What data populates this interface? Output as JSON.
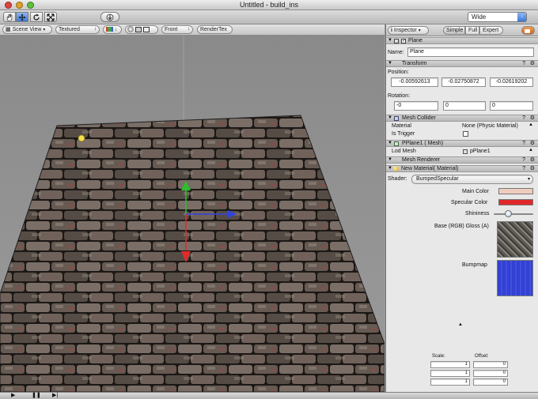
{
  "window": {
    "title": "Untitled - build_ins",
    "buttons": {
      "close": "#e0443e",
      "minimize": "#dea123",
      "zoom": "#5ec03a"
    }
  },
  "toolbar": {
    "tools": [
      "hand-icon",
      "move-icon",
      "rotate-icon",
      "scale-icon"
    ],
    "center_button": "orbit-icon",
    "layout_select": "Wide"
  },
  "scene_bar": {
    "view_select": "Scene View",
    "shading_select": "Textured",
    "front_select": "Front",
    "render_button": "RenderTex"
  },
  "inspector": {
    "tab_label": "Inspector",
    "mode_simple": "Simple",
    "mode_full": "Full",
    "mode_expert": "Expert",
    "object_header": "Plane",
    "name_label": "Name:",
    "name_value": "Plane",
    "transform": {
      "header": "Transform",
      "position_label": "Position:",
      "position": [
        "-0.00592613",
        "-0.02750872",
        "-0.02619202"
      ],
      "rotation_label": "Rotation:",
      "rotation": [
        "-0",
        "0",
        "0"
      ]
    },
    "mesh_collider": {
      "header": "Mesh Collider",
      "material_label": "Material",
      "material_value": "None (Physic Material)",
      "is_trigger_label": "Is Trigger"
    },
    "pplane": {
      "header": "PPlane1 ( Mesh)",
      "lod_label": "Lod Mesh",
      "lod_value": "pPlane1"
    },
    "mesh_renderer": {
      "header": "Mesh Renderer"
    },
    "material": {
      "header": "New  Material( Material)",
      "shader_label": "Shader:",
      "shader_value": "BumpedSpecular",
      "main_color_label": "Main Color",
      "main_color": "#f0cdbf",
      "specular_label": "Specular Color",
      "specular_color": "#e0282a",
      "shininess_label": "Shininess",
      "shininess": 0.45,
      "base_label": "Base (RGB) Gloss (A)",
      "bump_label": "Bumpmap",
      "scale_label": "Scale:",
      "offset_label": "Offset:",
      "scale_values": [
        "1",
        "1",
        "1"
      ],
      "offset_values": [
        "0",
        "0",
        "0"
      ]
    }
  },
  "accent": "#3b79d8"
}
